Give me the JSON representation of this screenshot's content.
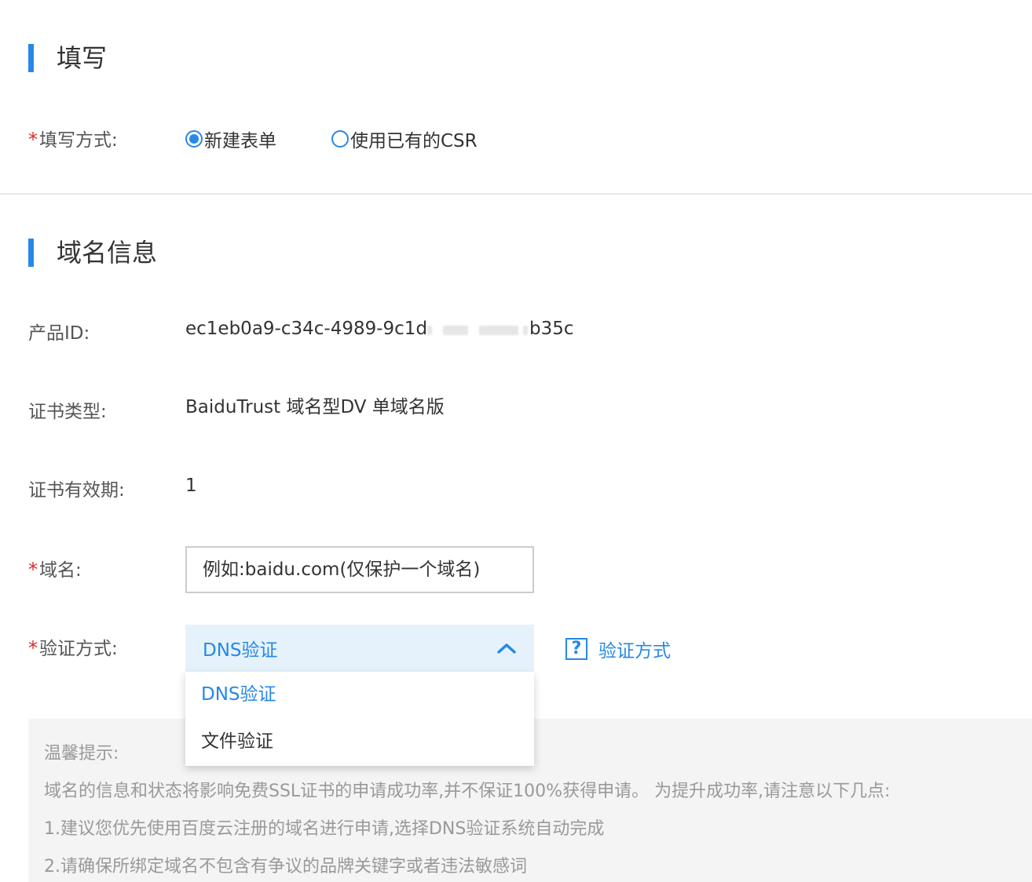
{
  "section1": {
    "title": "填写"
  },
  "fill_method": {
    "required": "*",
    "label": "填写方式:",
    "options": [
      {
        "label": "新建表单",
        "selected": true
      },
      {
        "label": "使用已有的CSR",
        "selected": false
      }
    ]
  },
  "section2": {
    "title": "域名信息"
  },
  "product_id": {
    "label": "产品ID:",
    "value_prefix": "ec1eb0a9-c34c-4989-9c1d",
    "value_suffix": "b35c"
  },
  "cert_type": {
    "label": "证书类型:",
    "value": "BaiduTrust 域名型DV 单域名版"
  },
  "cert_validity": {
    "label": "证书有效期:",
    "value": "1"
  },
  "domain": {
    "required": "*",
    "label": "域名:",
    "placeholder": "例如:baidu.com(仅保护一个域名)"
  },
  "verify": {
    "required": "*",
    "label": "验证方式:",
    "selected": "DNS验证",
    "options": [
      "DNS验证",
      "文件验证"
    ],
    "help_label": "验证方式",
    "help_icon": "question-icon"
  },
  "tips": {
    "title": "温馨提示:",
    "lines": [
      "域名的信息和状态将影响免费SSL证书的申请成功率,并不保证100%获得申请。 为提升成功率,请注意以下几点:",
      "1.建议您优先使用百度云注册的域名进行申请,选择DNS验证系统自动完成",
      "2.请确保所绑定域名不包含有争议的品牌关键字或者违法敏感词"
    ]
  },
  "colors": {
    "accent": "#2688e8",
    "required": "#e02828",
    "select_bg": "#e6f2fb"
  }
}
